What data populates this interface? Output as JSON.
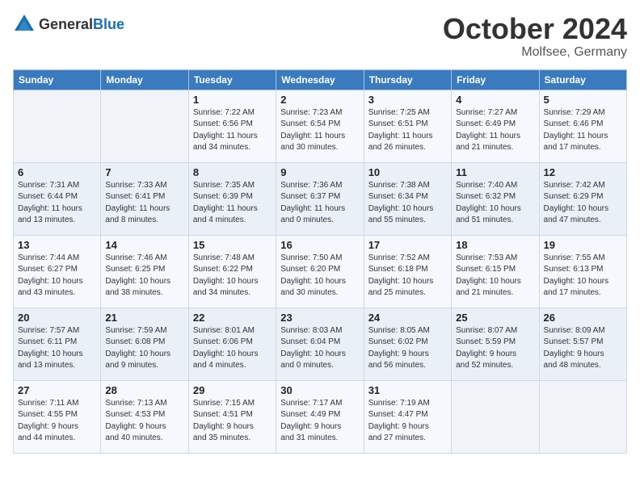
{
  "header": {
    "logo_general": "General",
    "logo_blue": "Blue",
    "title": "October 2024",
    "subtitle": "Molfsee, Germany"
  },
  "weekdays": [
    "Sunday",
    "Monday",
    "Tuesday",
    "Wednesday",
    "Thursday",
    "Friday",
    "Saturday"
  ],
  "weeks": [
    [
      {
        "day": "",
        "info": ""
      },
      {
        "day": "",
        "info": ""
      },
      {
        "day": "1",
        "info": "Sunrise: 7:22 AM\nSunset: 6:56 PM\nDaylight: 11 hours\nand 34 minutes."
      },
      {
        "day": "2",
        "info": "Sunrise: 7:23 AM\nSunset: 6:54 PM\nDaylight: 11 hours\nand 30 minutes."
      },
      {
        "day": "3",
        "info": "Sunrise: 7:25 AM\nSunset: 6:51 PM\nDaylight: 11 hours\nand 26 minutes."
      },
      {
        "day": "4",
        "info": "Sunrise: 7:27 AM\nSunset: 6:49 PM\nDaylight: 11 hours\nand 21 minutes."
      },
      {
        "day": "5",
        "info": "Sunrise: 7:29 AM\nSunset: 6:46 PM\nDaylight: 11 hours\nand 17 minutes."
      }
    ],
    [
      {
        "day": "6",
        "info": "Sunrise: 7:31 AM\nSunset: 6:44 PM\nDaylight: 11 hours\nand 13 minutes."
      },
      {
        "day": "7",
        "info": "Sunrise: 7:33 AM\nSunset: 6:41 PM\nDaylight: 11 hours\nand 8 minutes."
      },
      {
        "day": "8",
        "info": "Sunrise: 7:35 AM\nSunset: 6:39 PM\nDaylight: 11 hours\nand 4 minutes."
      },
      {
        "day": "9",
        "info": "Sunrise: 7:36 AM\nSunset: 6:37 PM\nDaylight: 11 hours\nand 0 minutes."
      },
      {
        "day": "10",
        "info": "Sunrise: 7:38 AM\nSunset: 6:34 PM\nDaylight: 10 hours\nand 55 minutes."
      },
      {
        "day": "11",
        "info": "Sunrise: 7:40 AM\nSunset: 6:32 PM\nDaylight: 10 hours\nand 51 minutes."
      },
      {
        "day": "12",
        "info": "Sunrise: 7:42 AM\nSunset: 6:29 PM\nDaylight: 10 hours\nand 47 minutes."
      }
    ],
    [
      {
        "day": "13",
        "info": "Sunrise: 7:44 AM\nSunset: 6:27 PM\nDaylight: 10 hours\nand 43 minutes."
      },
      {
        "day": "14",
        "info": "Sunrise: 7:46 AM\nSunset: 6:25 PM\nDaylight: 10 hours\nand 38 minutes."
      },
      {
        "day": "15",
        "info": "Sunrise: 7:48 AM\nSunset: 6:22 PM\nDaylight: 10 hours\nand 34 minutes."
      },
      {
        "day": "16",
        "info": "Sunrise: 7:50 AM\nSunset: 6:20 PM\nDaylight: 10 hours\nand 30 minutes."
      },
      {
        "day": "17",
        "info": "Sunrise: 7:52 AM\nSunset: 6:18 PM\nDaylight: 10 hours\nand 25 minutes."
      },
      {
        "day": "18",
        "info": "Sunrise: 7:53 AM\nSunset: 6:15 PM\nDaylight: 10 hours\nand 21 minutes."
      },
      {
        "day": "19",
        "info": "Sunrise: 7:55 AM\nSunset: 6:13 PM\nDaylight: 10 hours\nand 17 minutes."
      }
    ],
    [
      {
        "day": "20",
        "info": "Sunrise: 7:57 AM\nSunset: 6:11 PM\nDaylight: 10 hours\nand 13 minutes."
      },
      {
        "day": "21",
        "info": "Sunrise: 7:59 AM\nSunset: 6:08 PM\nDaylight: 10 hours\nand 9 minutes."
      },
      {
        "day": "22",
        "info": "Sunrise: 8:01 AM\nSunset: 6:06 PM\nDaylight: 10 hours\nand 4 minutes."
      },
      {
        "day": "23",
        "info": "Sunrise: 8:03 AM\nSunset: 6:04 PM\nDaylight: 10 hours\nand 0 minutes."
      },
      {
        "day": "24",
        "info": "Sunrise: 8:05 AM\nSunset: 6:02 PM\nDaylight: 9 hours\nand 56 minutes."
      },
      {
        "day": "25",
        "info": "Sunrise: 8:07 AM\nSunset: 5:59 PM\nDaylight: 9 hours\nand 52 minutes."
      },
      {
        "day": "26",
        "info": "Sunrise: 8:09 AM\nSunset: 5:57 PM\nDaylight: 9 hours\nand 48 minutes."
      }
    ],
    [
      {
        "day": "27",
        "info": "Sunrise: 7:11 AM\nSunset: 4:55 PM\nDaylight: 9 hours\nand 44 minutes."
      },
      {
        "day": "28",
        "info": "Sunrise: 7:13 AM\nSunset: 4:53 PM\nDaylight: 9 hours\nand 40 minutes."
      },
      {
        "day": "29",
        "info": "Sunrise: 7:15 AM\nSunset: 4:51 PM\nDaylight: 9 hours\nand 35 minutes."
      },
      {
        "day": "30",
        "info": "Sunrise: 7:17 AM\nSunset: 4:49 PM\nDaylight: 9 hours\nand 31 minutes."
      },
      {
        "day": "31",
        "info": "Sunrise: 7:19 AM\nSunset: 4:47 PM\nDaylight: 9 hours\nand 27 minutes."
      },
      {
        "day": "",
        "info": ""
      },
      {
        "day": "",
        "info": ""
      }
    ]
  ]
}
